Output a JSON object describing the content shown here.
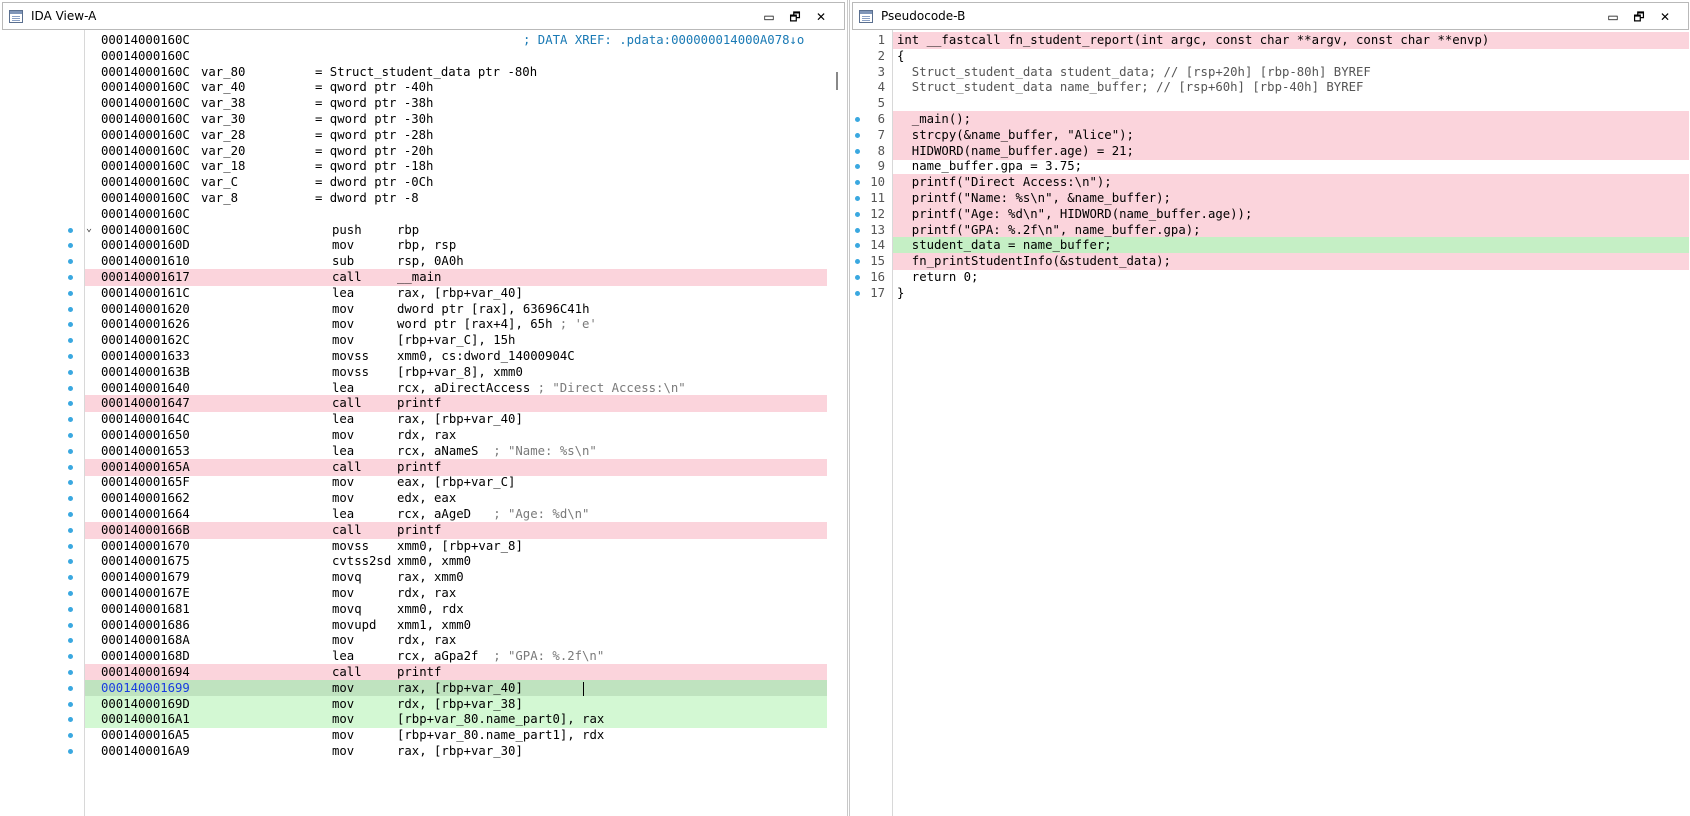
{
  "pane_a": {
    "title": "IDA View-A",
    "lines": [
      {
        "addr": "00014000160C",
        "label": "",
        "mn": "",
        "op": "",
        "comment": "",
        "xref": "; DATA XREF: .pdata:000000014000A078↓o",
        "hl": ""
      },
      {
        "addr": "00014000160C",
        "label": "",
        "mn": "",
        "op": "",
        "comment": "",
        "xref": "",
        "hl": ""
      },
      {
        "addr": "00014000160C",
        "label": "var_80",
        "mn": "= Struct_student_data ptr -80h",
        "op": "",
        "comment": "",
        "xref": "",
        "hl": ""
      },
      {
        "addr": "00014000160C",
        "label": "var_40",
        "mn": "= qword ptr -40h",
        "op": "",
        "comment": "",
        "xref": "",
        "hl": ""
      },
      {
        "addr": "00014000160C",
        "label": "var_38",
        "mn": "= qword ptr -38h",
        "op": "",
        "comment": "",
        "xref": "",
        "hl": ""
      },
      {
        "addr": "00014000160C",
        "label": "var_30",
        "mn": "= qword ptr -30h",
        "op": "",
        "comment": "",
        "xref": "",
        "hl": ""
      },
      {
        "addr": "00014000160C",
        "label": "var_28",
        "mn": "= qword ptr -28h",
        "op": "",
        "comment": "",
        "xref": "",
        "hl": ""
      },
      {
        "addr": "00014000160C",
        "label": "var_20",
        "mn": "= qword ptr -20h",
        "op": "",
        "comment": "",
        "xref": "",
        "hl": ""
      },
      {
        "addr": "00014000160C",
        "label": "var_18",
        "mn": "= qword ptr -18h",
        "op": "",
        "comment": "",
        "xref": "",
        "hl": ""
      },
      {
        "addr": "00014000160C",
        "label": "var_C",
        "mn": "= dword ptr -0Ch",
        "op": "",
        "comment": "",
        "xref": "",
        "hl": ""
      },
      {
        "addr": "00014000160C",
        "label": "var_8",
        "mn": "= dword ptr -8",
        "op": "",
        "comment": "",
        "xref": "",
        "hl": ""
      },
      {
        "addr": "00014000160C",
        "label": "",
        "mn": "",
        "op": "",
        "comment": "",
        "xref": "",
        "hl": ""
      },
      {
        "addr": "00014000160C",
        "label": "",
        "mn": "push",
        "op": "rbp",
        "comment": "",
        "xref": "",
        "hl": ""
      },
      {
        "addr": "00014000160D",
        "label": "",
        "mn": "mov",
        "op": "rbp, rsp",
        "comment": "",
        "xref": "",
        "hl": ""
      },
      {
        "addr": "000140001610",
        "label": "",
        "mn": "sub",
        "op": "rsp, 0A0h",
        "comment": "",
        "xref": "",
        "hl": ""
      },
      {
        "addr": "000140001617",
        "label": "",
        "mn": "call",
        "op": "__main",
        "comment": "",
        "xref": "",
        "hl": "red"
      },
      {
        "addr": "00014000161C",
        "label": "",
        "mn": "lea",
        "op": "rax, [rbp+var_40]",
        "comment": "",
        "xref": "",
        "hl": ""
      },
      {
        "addr": "000140001620",
        "label": "",
        "mn": "mov",
        "op": "dword ptr [rax], 63696C41h",
        "comment": "",
        "xref": "",
        "hl": ""
      },
      {
        "addr": "000140001626",
        "label": "",
        "mn": "mov",
        "op": "word ptr [rax+4], 65h",
        "comment": "; 'e'",
        "xref": "",
        "hl": ""
      },
      {
        "addr": "00014000162C",
        "label": "",
        "mn": "mov",
        "op": "[rbp+var_C], 15h",
        "comment": "",
        "xref": "",
        "hl": ""
      },
      {
        "addr": "000140001633",
        "label": "",
        "mn": "movss",
        "op": "xmm0, cs:dword_14000904C",
        "comment": "",
        "xref": "",
        "hl": ""
      },
      {
        "addr": "00014000163B",
        "label": "",
        "mn": "movss",
        "op": "[rbp+var_8], xmm0",
        "comment": "",
        "xref": "",
        "hl": ""
      },
      {
        "addr": "000140001640",
        "label": "",
        "mn": "lea",
        "op": "rcx, aDirectAccess",
        "comment": "; \"Direct Access:\\n\"",
        "xref": "",
        "hl": ""
      },
      {
        "addr": "000140001647",
        "label": "",
        "mn": "call",
        "op": "printf",
        "comment": "",
        "xref": "",
        "hl": "red"
      },
      {
        "addr": "00014000164C",
        "label": "",
        "mn": "lea",
        "op": "rax, [rbp+var_40]",
        "comment": "",
        "xref": "",
        "hl": ""
      },
      {
        "addr": "000140001650",
        "label": "",
        "mn": "mov",
        "op": "rdx, rax",
        "comment": "",
        "xref": "",
        "hl": ""
      },
      {
        "addr": "000140001653",
        "label": "",
        "mn": "lea",
        "op": "rcx, aNameS",
        "comment": "; \"Name: %s\\n\"",
        "xref": "",
        "hl": ""
      },
      {
        "addr": "00014000165A",
        "label": "",
        "mn": "call",
        "op": "printf",
        "comment": "",
        "xref": "",
        "hl": "red"
      },
      {
        "addr": "00014000165F",
        "label": "",
        "mn": "mov",
        "op": "eax, [rbp+var_C]",
        "comment": "",
        "xref": "",
        "hl": ""
      },
      {
        "addr": "000140001662",
        "label": "",
        "mn": "mov",
        "op": "edx, eax",
        "comment": "",
        "xref": "",
        "hl": ""
      },
      {
        "addr": "000140001664",
        "label": "",
        "mn": "lea",
        "op": "rcx, aAgeD",
        "comment": "; \"Age: %d\\n\"",
        "xref": "",
        "hl": ""
      },
      {
        "addr": "00014000166B",
        "label": "",
        "mn": "call",
        "op": "printf",
        "comment": "",
        "xref": "",
        "hl": "red"
      },
      {
        "addr": "000140001670",
        "label": "",
        "mn": "movss",
        "op": "xmm0, [rbp+var_8]",
        "comment": "",
        "xref": "",
        "hl": ""
      },
      {
        "addr": "000140001675",
        "label": "",
        "mn": "cvtss2sd",
        "op": "xmm0, xmm0",
        "comment": "",
        "xref": "",
        "hl": ""
      },
      {
        "addr": "000140001679",
        "label": "",
        "mn": "movq",
        "op": "rax, xmm0",
        "comment": "",
        "xref": "",
        "hl": ""
      },
      {
        "addr": "00014000167E",
        "label": "",
        "mn": "mov",
        "op": "rdx, rax",
        "comment": "",
        "xref": "",
        "hl": ""
      },
      {
        "addr": "000140001681",
        "label": "",
        "mn": "movq",
        "op": "xmm0, rdx",
        "comment": "",
        "xref": "",
        "hl": ""
      },
      {
        "addr": "000140001686",
        "label": "",
        "mn": "movupd",
        "op": "xmm1, xmm0",
        "comment": "",
        "xref": "",
        "hl": ""
      },
      {
        "addr": "00014000168A",
        "label": "",
        "mn": "mov",
        "op": "rdx, rax",
        "comment": "",
        "xref": "",
        "hl": ""
      },
      {
        "addr": "00014000168D",
        "label": "",
        "mn": "lea",
        "op": "rcx, aGpa2f",
        "comment": "; \"GPA: %.2f\\n\"",
        "xref": "",
        "hl": ""
      },
      {
        "addr": "000140001694",
        "label": "",
        "mn": "call",
        "op": "printf",
        "comment": "",
        "xref": "",
        "hl": "red"
      },
      {
        "addr": "000140001699",
        "label": "",
        "mn": "mov",
        "op": "rax, [rbp+var_40]",
        "comment": "",
        "xref": "",
        "hl": "sel"
      },
      {
        "addr": "00014000169D",
        "label": "",
        "mn": "mov",
        "op": "rdx, [rbp+var_38]",
        "comment": "",
        "xref": "",
        "hl": "green"
      },
      {
        "addr": "0001400016A1",
        "label": "",
        "mn": "mov",
        "op": "[rbp+var_80.name_part0], rax",
        "comment": "",
        "xref": "",
        "hl": "green"
      },
      {
        "addr": "0001400016A5",
        "label": "",
        "mn": "mov",
        "op": "[rbp+var_80.name_part1], rdx",
        "comment": "",
        "xref": "",
        "hl": ""
      },
      {
        "addr": "0001400016A9",
        "label": "",
        "mn": "mov",
        "op": "rax, [rbp+var_30]",
        "comment": "",
        "xref": "",
        "hl": ""
      }
    ]
  },
  "pane_b": {
    "title": "Pseudocode-B",
    "lines": [
      {
        "n": "1",
        "text": "int __fastcall fn_student_report(int argc, const char **argv, const char **envp)",
        "hl": "red",
        "dot": false
      },
      {
        "n": "2",
        "text": "{",
        "hl": "",
        "dot": false
      },
      {
        "n": "3",
        "text": "  Struct_student_data student_data; // [rsp+20h] [rbp-80h] BYREF",
        "hl": "",
        "dot": false
      },
      {
        "n": "4",
        "text": "  Struct_student_data name_buffer; // [rsp+60h] [rbp-40h] BYREF",
        "hl": "",
        "dot": false
      },
      {
        "n": "5",
        "text": "",
        "hl": "",
        "dot": false
      },
      {
        "n": "6",
        "text": "  _main();",
        "hl": "red",
        "dot": true
      },
      {
        "n": "7",
        "text": "  strcpy(&name_buffer, \"Alice\");",
        "hl": "red",
        "dot": true
      },
      {
        "n": "8",
        "text": "  HIDWORD(name_buffer.age) = 21;",
        "hl": "red",
        "dot": true
      },
      {
        "n": "9",
        "text": "  name_buffer.gpa = 3.75;",
        "hl": "",
        "dot": true
      },
      {
        "n": "10",
        "text": "  printf(\"Direct Access:\\n\");",
        "hl": "red",
        "dot": true
      },
      {
        "n": "11",
        "text": "  printf(\"Name: %s\\n\", &name_buffer);",
        "hl": "red",
        "dot": true
      },
      {
        "n": "12",
        "text": "  printf(\"Age: %d\\n\", HIDWORD(name_buffer.age));",
        "hl": "red",
        "dot": true
      },
      {
        "n": "13",
        "text": "  printf(\"GPA: %.2f\\n\", name_buffer.gpa);",
        "hl": "red",
        "dot": true
      },
      {
        "n": "14",
        "text": "  student_data = name_buffer;",
        "hl": "green",
        "dot": true
      },
      {
        "n": "15",
        "text": "  fn_printStudentInfo(&student_data);",
        "hl": "red",
        "dot": true
      },
      {
        "n": "16",
        "text": "  return 0;",
        "hl": "",
        "dot": true
      },
      {
        "n": "17",
        "text": "}",
        "hl": "",
        "dot": true
      }
    ]
  },
  "window_buttons": {
    "minimize": "▭",
    "restore": "🗗",
    "close": "✕"
  },
  "colors": {
    "highlight_red": "#fbd4dc",
    "highlight_green": "#d3f8d3",
    "selected_green": "#bfe3bf",
    "dot_blue": "#3aa8e0"
  }
}
